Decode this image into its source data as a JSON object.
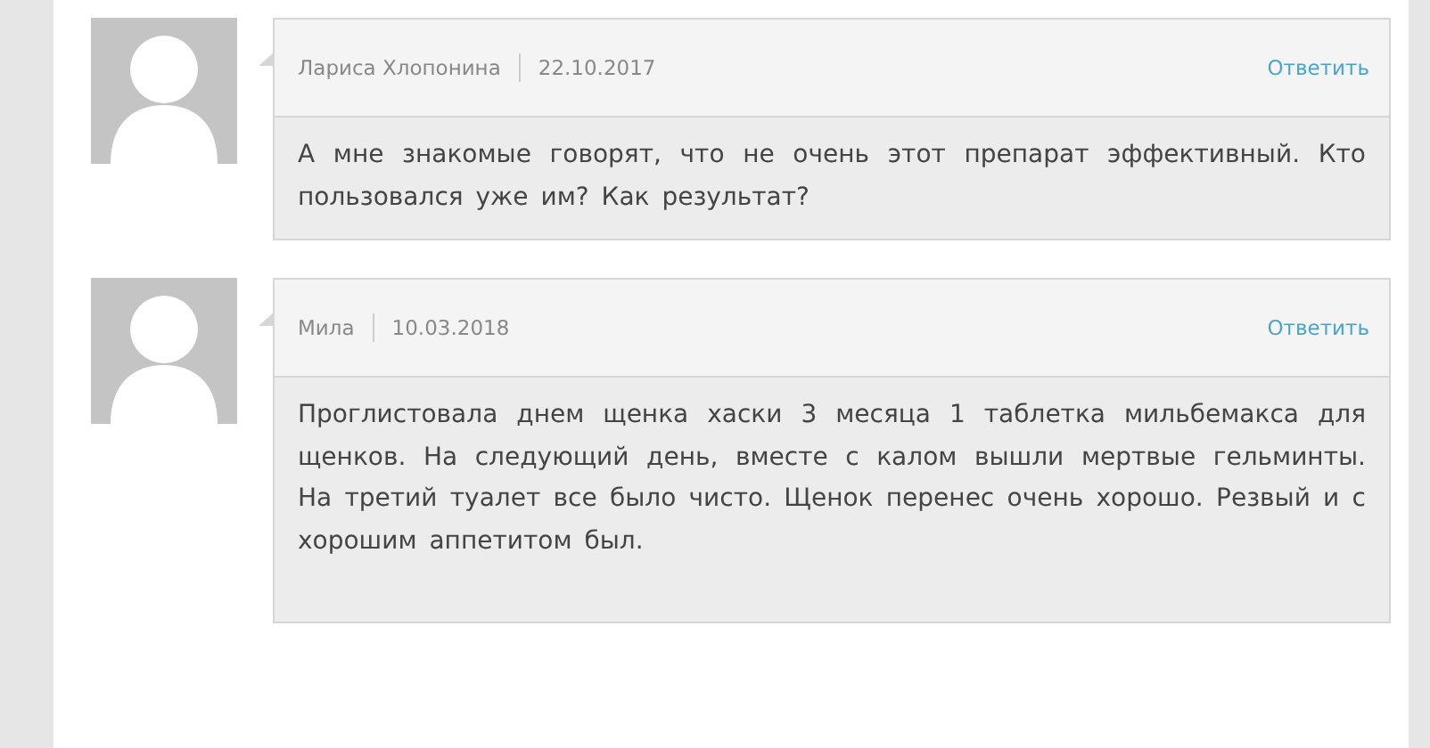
{
  "comments": [
    {
      "author": "Лариса Хлопонина",
      "date": "22.10.2017",
      "reply": "Ответить",
      "text": "А мне знакомые говорят, что не очень этот препарат эффективный. Кто пользовался уже им? Как результат?"
    },
    {
      "author": "Мила",
      "date": "10.03.2018",
      "reply": "Ответить",
      "text": "Проглистовала днем щенка хаски 3 месяца 1 таблетка мильбемакса для щенков. На следующий день, вместе с калом вышли мертвые гельминты. На третий туалет все было чисто. Щенок перенес очень хорошо. Резвый и с хорошим аппетитом был."
    }
  ]
}
